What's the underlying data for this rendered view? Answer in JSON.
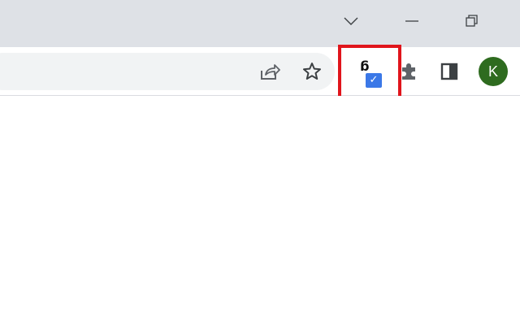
{
  "titlebar": {
    "buttons": [
      "tab-search-icon",
      "minimize-icon",
      "restore-icon"
    ]
  },
  "toolbar": {
    "icons": [
      "share-icon",
      "star-icon",
      "extension-g-check-icon",
      "puzzle-icon",
      "side-panel-icon"
    ]
  },
  "extension": {
    "glyph": "g",
    "check": "✓",
    "badge_color": "#3b78e7"
  },
  "profile": {
    "initial": "K",
    "color": "#2e6b1f"
  },
  "highlight_color": "#e0151c"
}
